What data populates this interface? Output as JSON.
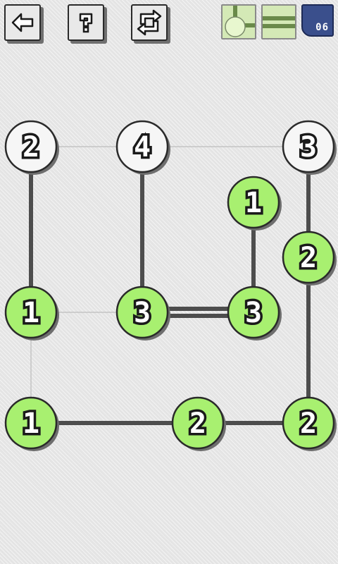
{
  "toolbar": {
    "back_icon": "←",
    "help_icon": "?",
    "reset_icon": "↻"
  },
  "level": {
    "number": "06"
  },
  "colors": {
    "node_done": "#a8f070",
    "node_open": "#f6f6f6",
    "bridge": "#4d4d4d",
    "hint_line": "#c4c4c4"
  },
  "nodes": [
    {
      "id": "a",
      "label": "2",
      "state": "open"
    },
    {
      "id": "b",
      "label": "4",
      "state": "open"
    },
    {
      "id": "c",
      "label": "3",
      "state": "open"
    },
    {
      "id": "d",
      "label": "1",
      "state": "done"
    },
    {
      "id": "e",
      "label": "2",
      "state": "done"
    },
    {
      "id": "f",
      "label": "1",
      "state": "done"
    },
    {
      "id": "g",
      "label": "3",
      "state": "done"
    },
    {
      "id": "h",
      "label": "3",
      "state": "done"
    },
    {
      "id": "i",
      "label": "1",
      "state": "done"
    },
    {
      "id": "j",
      "label": "2",
      "state": "done"
    },
    {
      "id": "k",
      "label": "2",
      "state": "done"
    }
  ],
  "bridges": [
    {
      "from": "a",
      "to": "f",
      "count": 1
    },
    {
      "from": "b",
      "to": "g",
      "count": 1
    },
    {
      "from": "d",
      "to": "h",
      "count": 1
    },
    {
      "from": "c",
      "to": "e",
      "count": 1
    },
    {
      "from": "e",
      "to": "k",
      "count": 1
    },
    {
      "from": "g",
      "to": "h",
      "count": 2
    },
    {
      "from": "i",
      "to": "j",
      "count": 1
    },
    {
      "from": "j",
      "to": "k",
      "count": 1
    }
  ],
  "hints": [
    {
      "from": "a",
      "to": "b"
    },
    {
      "from": "b",
      "to": "c"
    },
    {
      "from": "f",
      "to": "g"
    },
    {
      "from": "f",
      "to": "i"
    }
  ]
}
